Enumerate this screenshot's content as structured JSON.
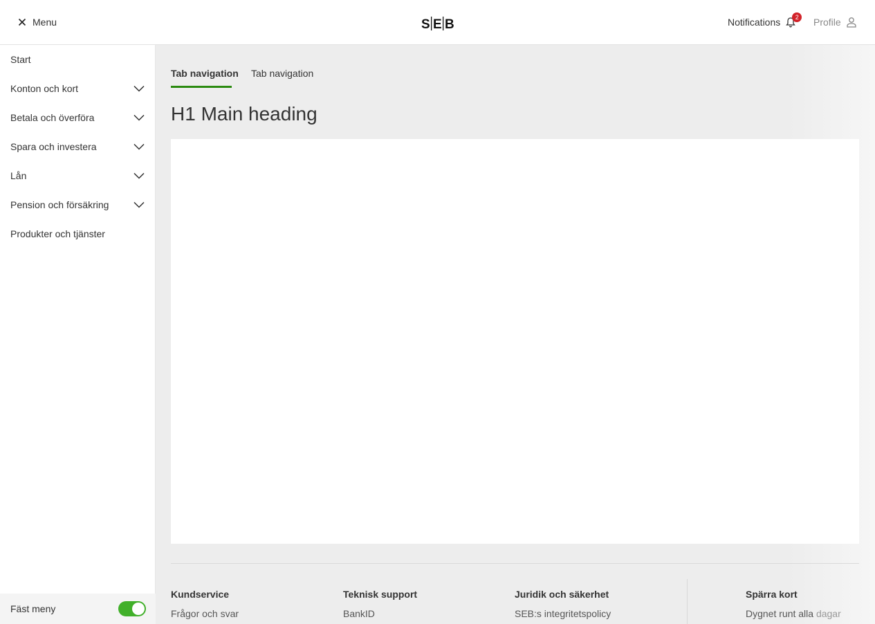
{
  "header": {
    "menu_label": "Menu",
    "notifications_label": "Notifications",
    "notifications_count": "2",
    "profile_label": "Profile",
    "logo_text": "SEB",
    "badge_color": "#d2232a"
  },
  "sidebar": {
    "items": [
      {
        "label": "Start",
        "expandable": false
      },
      {
        "label": "Konton och kort",
        "expandable": true
      },
      {
        "label": "Betala och överföra",
        "expandable": true
      },
      {
        "label": "Spara och investera",
        "expandable": true
      },
      {
        "label": "Lån",
        "expandable": true
      },
      {
        "label": "Pension och försäkring",
        "expandable": true
      },
      {
        "label": "Produkter och tjänster",
        "expandable": false
      }
    ],
    "pin_label": "Fäst meny",
    "pin_enabled": true,
    "toggle_color": "#41b02a"
  },
  "main": {
    "tabs": [
      {
        "label": "Tab navigation",
        "active": true
      },
      {
        "label": "Tab navigation",
        "active": false
      }
    ],
    "heading": "H1 Main heading",
    "accent_color": "#2a8a0f"
  },
  "footer": {
    "columns": [
      {
        "heading": "Kundservice",
        "link": "Frågor och svar"
      },
      {
        "heading": "Teknisk support",
        "link": "BankID"
      },
      {
        "heading": "Juridik och säkerhet",
        "link": "SEB:s integritetspolicy"
      }
    ],
    "block_card": {
      "heading": "Spärra kort",
      "text_a": "Dygnet runt alla",
      "text_b": "dagar"
    }
  }
}
